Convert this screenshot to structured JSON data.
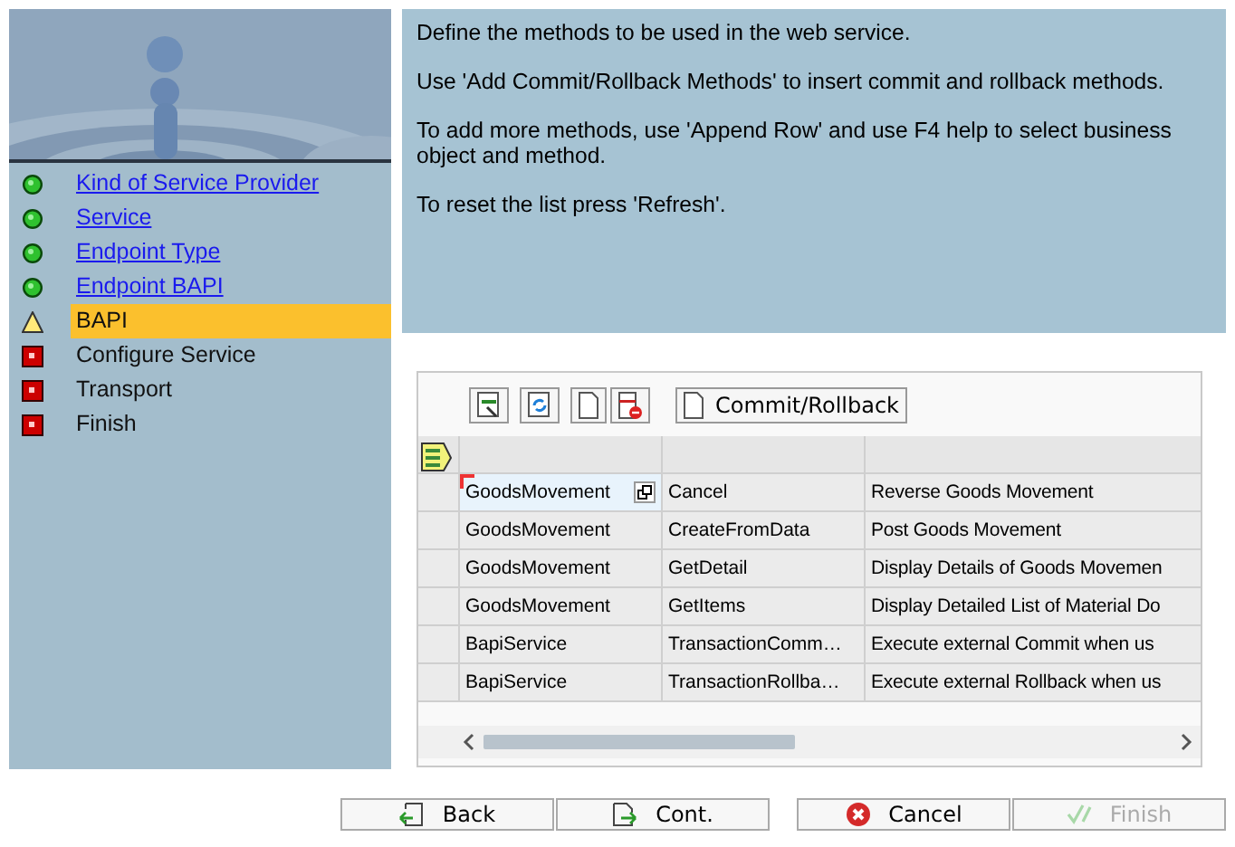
{
  "steps": [
    {
      "label": "Kind of Service Provider",
      "kind": "done",
      "link": true,
      "selected": false
    },
    {
      "label": "Service",
      "kind": "done",
      "link": true,
      "selected": false
    },
    {
      "label": "Endpoint Type",
      "kind": "done",
      "link": true,
      "selected": false
    },
    {
      "label": "Endpoint BAPI",
      "kind": "done",
      "link": true,
      "selected": false
    },
    {
      "label": "BAPI",
      "kind": "current",
      "link": false,
      "selected": true
    },
    {
      "label": "Configure Service",
      "kind": "pending",
      "link": false,
      "selected": false
    },
    {
      "label": "Transport",
      "kind": "pending",
      "link": false,
      "selected": false
    },
    {
      "label": "Finish",
      "kind": "pending",
      "link": false,
      "selected": false
    }
  ],
  "instructions": [
    "Define the methods to be used in the web service.",
    "Use 'Add Commit/Rollback Methods' to insert commit and rollback methods.",
    "To add more methods, use 'Append Row' and use F4 help to select business object and method.",
    "To reset the list press 'Refresh'."
  ],
  "toolbar": {
    "commit_button": "Commit/Rollback"
  },
  "table": {
    "rows": [
      {
        "column_1": "GoodsMovement",
        "column_2": "Cancel",
        "column_3": "Reverse Goods Movement",
        "focused": true
      },
      {
        "column_1": "GoodsMovement",
        "column_2": "CreateFromData",
        "column_3": "Post Goods Movement",
        "focused": false
      },
      {
        "column_1": "GoodsMovement",
        "column_2": "GetDetail",
        "column_3": "Display Details of Goods Movemen",
        "focused": false
      },
      {
        "column_1": "GoodsMovement",
        "column_2": "GetItems",
        "column_3": "Display Detailed List of Material Do",
        "focused": false
      },
      {
        "column_1": "BapiService",
        "column_2": "TransactionComm…",
        "column_3": "Execute external Commit when us",
        "focused": false
      },
      {
        "column_1": "BapiService",
        "column_2": "TransactionRollba…",
        "column_3": "Execute external Rollback when us",
        "focused": false
      }
    ]
  },
  "buttons": [
    {
      "label": "Back",
      "kind": "back",
      "disabled": false
    },
    {
      "label": "Cont.",
      "kind": "continue",
      "disabled": false
    },
    {
      "label": "Cancel",
      "kind": "cancel",
      "disabled": false
    },
    {
      "label": "Finish",
      "kind": "finish",
      "disabled": true
    }
  ]
}
